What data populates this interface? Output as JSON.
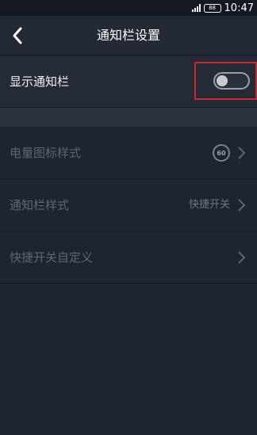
{
  "status_bar": {
    "battery_label": "88",
    "time": "10:47",
    "signal_icon": "signal-icon",
    "battery_icon": "battery-icon"
  },
  "header": {
    "title": "通知栏设置",
    "back_icon": "chevron-left-icon"
  },
  "toggle_row": {
    "label": "显示通知栏",
    "enabled": false
  },
  "settings_list": [
    {
      "label": "电量图标样式",
      "badge": "60",
      "value": ""
    },
    {
      "label": "通知栏样式",
      "value": "快捷开关"
    },
    {
      "label": "快捷开关自定义",
      "value": ""
    }
  ],
  "colors": {
    "background": "#1f252f",
    "header": "#232a35",
    "highlight": "#d3242a",
    "disabled_text": "#5d6672"
  }
}
